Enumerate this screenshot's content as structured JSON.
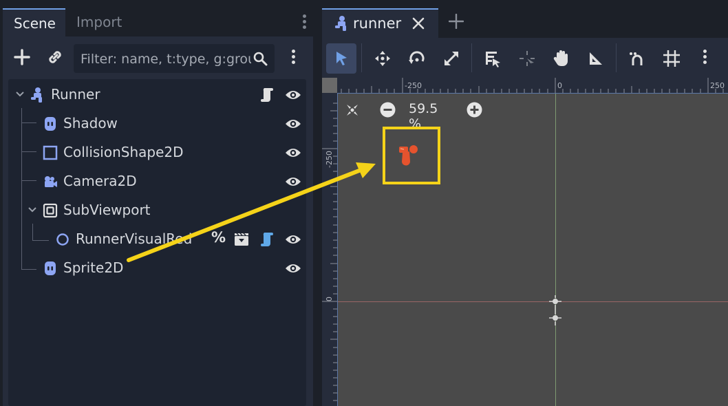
{
  "dock": {
    "tabs": [
      {
        "label": "Scene",
        "active": true
      },
      {
        "label": "Import",
        "active": false
      }
    ]
  },
  "scene_toolbar": {
    "filter_placeholder": "Filter: name, t:type, g:group"
  },
  "tree": {
    "nodes": [
      {
        "label": "Runner",
        "icon": "character-body-icon",
        "depth": 0,
        "expanded": true,
        "extra_icons": [
          "script-icon"
        ]
      },
      {
        "label": "Shadow",
        "icon": "sprite-icon",
        "depth": 1
      },
      {
        "label": "CollisionShape2D",
        "icon": "collision-shape-icon",
        "depth": 1
      },
      {
        "label": "Camera2D",
        "icon": "camera-icon",
        "depth": 1
      },
      {
        "label": "SubViewport",
        "icon": "subviewport-icon",
        "depth": 1,
        "expanded": true
      },
      {
        "label": "RunnerVisualRed",
        "icon": "node3d-icon",
        "depth": 2,
        "extra_icons": [
          "unique-name-icon",
          "instance-icon",
          "script-icon"
        ]
      },
      {
        "label": "Sprite2D",
        "icon": "sprite-icon",
        "depth": 1
      }
    ]
  },
  "editor": {
    "scene_tab": {
      "label": "runner"
    },
    "zoom": "59.5 %",
    "ruler_top": [
      "-250",
      "0",
      "250"
    ],
    "ruler_left": [
      "-250",
      "0"
    ]
  },
  "colors": {
    "accent": "#70a0e6",
    "node_icon": "#8da5f3",
    "highlight": "#f5d319",
    "viewport_bg": "#4a4a4a",
    "character": "#e5532e"
  }
}
